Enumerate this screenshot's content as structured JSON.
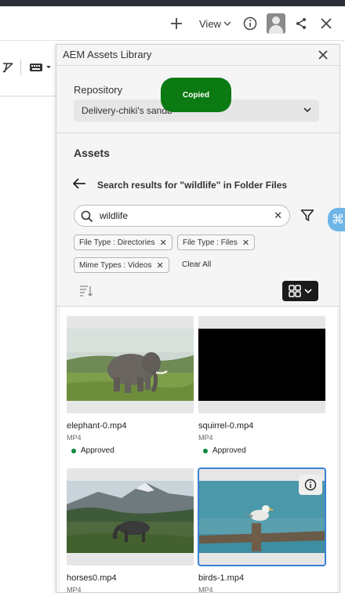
{
  "toolbar": {
    "view_label": "View"
  },
  "panel": {
    "title": "AEM Assets Library",
    "repository_label": "Repository",
    "repository_value": "Delivery-chiki's sandb",
    "toast": "Copied",
    "assets_title": "Assets",
    "search_result_text": "Search results for \"wildlife\" in Folder Files",
    "search_value": "wildlife",
    "chips": [
      {
        "label": "File Type : Directories"
      },
      {
        "label": "File Type : Files"
      },
      {
        "label": "Mime Types : Videos"
      }
    ],
    "clear_all": "Clear All"
  },
  "assets": [
    {
      "name": "elephant-0.mp4",
      "type": "MP4",
      "status": "Approved"
    },
    {
      "name": "squirrel-0.mp4",
      "type": "MP4",
      "status": "Approved"
    },
    {
      "name": "horses0.mp4",
      "type": "MP4",
      "status": ""
    },
    {
      "name": "birds-1.mp4",
      "type": "MP4",
      "status": ""
    }
  ],
  "colors": {
    "toast_bg": "#0c7a12",
    "approved_dot": "#0d8a3e",
    "selection": "#3b82d6"
  },
  "icons": [
    "plus-icon",
    "chevron-down-icon",
    "info-icon",
    "avatar",
    "share-icon",
    "close-icon",
    "search-icon",
    "filter-icon",
    "sort-icon",
    "grid-view-icon",
    "back-arrow-icon",
    "command-icon"
  ]
}
